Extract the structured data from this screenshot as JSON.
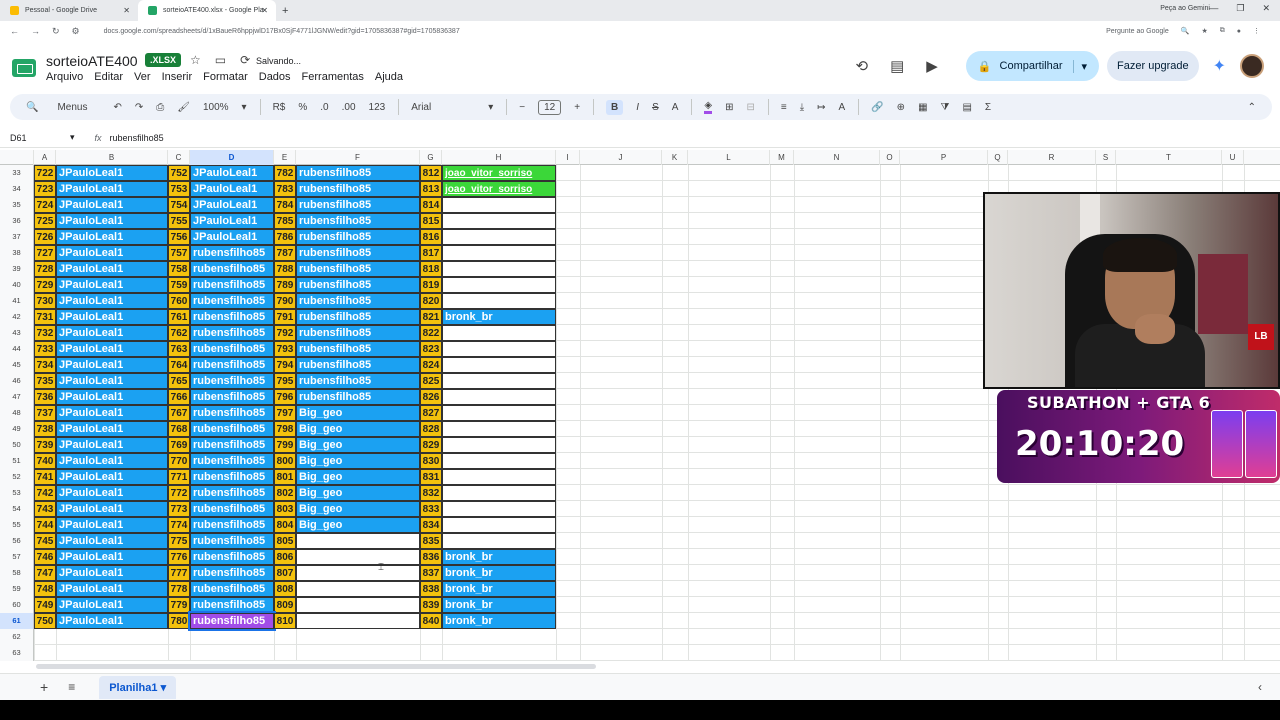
{
  "browser": {
    "tabs": [
      {
        "label": "Pessoal - Google Drive",
        "active": false
      },
      {
        "label": "sorteioATE400.xlsx - Google Pla",
        "active": true
      }
    ],
    "gemini_label": "Peça ao Gemini",
    "url": "docs.google.com/spreadsheets/d/1xBaueR6hppjwlD17Bx0SjF4771lJGNW/edit?gid=1705836387#gid=1705836387",
    "gemini_ask": "Pergunte ao Google"
  },
  "doc": {
    "title": "sorteioATE400",
    "badge": ".XLSX",
    "status": "Salvando...",
    "menus": [
      "Arquivo",
      "Editar",
      "Ver",
      "Inserir",
      "Formatar",
      "Dados",
      "Ferramentas",
      "Ajuda"
    ],
    "share_label": "Compartilhar",
    "upgrade_label": "Fazer upgrade"
  },
  "toolbar": {
    "menus_label": "Menus",
    "zoom": "100%",
    "currency": "R$",
    "percent": "%",
    "dec_less": ".0",
    "dec_more": ".00",
    "format_123": "123",
    "font": "Arial",
    "font_size": "12"
  },
  "formula_bar": {
    "cell_ref": "D61",
    "fx": "fx",
    "content": "rubensfilho85"
  },
  "columns": [
    "A",
    "B",
    "C",
    "D",
    "E",
    "F",
    "G",
    "H",
    "I",
    "J",
    "K",
    "L",
    "M",
    "N",
    "O",
    "P",
    "Q",
    "R",
    "S",
    "T",
    "U"
  ],
  "rows": [
    {
      "n": "33",
      "a": "722",
      "b": "JPauloLeal1",
      "c": "752",
      "d": "JPauloLeal1",
      "e": "782",
      "f": "rubensfilho85",
      "g": "812",
      "h": "joao_vitor_sorriso",
      "hs": "green"
    },
    {
      "n": "34",
      "a": "723",
      "b": "JPauloLeal1",
      "c": "753",
      "d": "JPauloLeal1",
      "e": "783",
      "f": "rubensfilho85",
      "g": "813",
      "h": "joao_vitor_sorriso",
      "hs": "green"
    },
    {
      "n": "35",
      "a": "724",
      "b": "JPauloLeal1",
      "c": "754",
      "d": "JPauloLeal1",
      "e": "784",
      "f": "rubensfilho85",
      "g": "814",
      "h": "",
      "hs": "blank"
    },
    {
      "n": "36",
      "a": "725",
      "b": "JPauloLeal1",
      "c": "755",
      "d": "JPauloLeal1",
      "e": "785",
      "f": "rubensfilho85",
      "g": "815",
      "h": "",
      "hs": "blank"
    },
    {
      "n": "37",
      "a": "726",
      "b": "JPauloLeal1",
      "c": "756",
      "d": "JPauloLeal1",
      "e": "786",
      "f": "rubensfilho85",
      "g": "816",
      "h": "",
      "hs": "blank"
    },
    {
      "n": "38",
      "a": "727",
      "b": "JPauloLeal1",
      "c": "757",
      "d": "rubensfilho85",
      "e": "787",
      "f": "rubensfilho85",
      "g": "817",
      "h": "",
      "hs": "blank"
    },
    {
      "n": "39",
      "a": "728",
      "b": "JPauloLeal1",
      "c": "758",
      "d": "rubensfilho85",
      "e": "788",
      "f": "rubensfilho85",
      "g": "818",
      "h": "",
      "hs": "blank"
    },
    {
      "n": "40",
      "a": "729",
      "b": "JPauloLeal1",
      "c": "759",
      "d": "rubensfilho85",
      "e": "789",
      "f": "rubensfilho85",
      "g": "819",
      "h": "",
      "hs": "blank"
    },
    {
      "n": "41",
      "a": "730",
      "b": "JPauloLeal1",
      "c": "760",
      "d": "rubensfilho85",
      "e": "790",
      "f": "rubensfilho85",
      "g": "820",
      "h": "",
      "hs": "blank"
    },
    {
      "n": "42",
      "a": "731",
      "b": "JPauloLeal1",
      "c": "761",
      "d": "rubensfilho85",
      "e": "791",
      "f": "rubensfilho85",
      "g": "821",
      "h": "bronk_br",
      "hs": "name"
    },
    {
      "n": "43",
      "a": "732",
      "b": "JPauloLeal1",
      "c": "762",
      "d": "rubensfilho85",
      "e": "792",
      "f": "rubensfilho85",
      "g": "822",
      "h": "",
      "hs": "blank"
    },
    {
      "n": "44",
      "a": "733",
      "b": "JPauloLeal1",
      "c": "763",
      "d": "rubensfilho85",
      "e": "793",
      "f": "rubensfilho85",
      "g": "823",
      "h": "",
      "hs": "blank"
    },
    {
      "n": "45",
      "a": "734",
      "b": "JPauloLeal1",
      "c": "764",
      "d": "rubensfilho85",
      "e": "794",
      "f": "rubensfilho85",
      "g": "824",
      "h": "",
      "hs": "blank"
    },
    {
      "n": "46",
      "a": "735",
      "b": "JPauloLeal1",
      "c": "765",
      "d": "rubensfilho85",
      "e": "795",
      "f": "rubensfilho85",
      "g": "825",
      "h": "",
      "hs": "blank"
    },
    {
      "n": "47",
      "a": "736",
      "b": "JPauloLeal1",
      "c": "766",
      "d": "rubensfilho85",
      "e": "796",
      "f": "rubensfilho85",
      "g": "826",
      "h": "",
      "hs": "blank"
    },
    {
      "n": "48",
      "a": "737",
      "b": "JPauloLeal1",
      "c": "767",
      "d": "rubensfilho85",
      "e": "797",
      "f": "Big_geo",
      "g": "827",
      "h": "",
      "hs": "blank"
    },
    {
      "n": "49",
      "a": "738",
      "b": "JPauloLeal1",
      "c": "768",
      "d": "rubensfilho85",
      "e": "798",
      "f": "Big_geo",
      "g": "828",
      "h": "",
      "hs": "blank"
    },
    {
      "n": "50",
      "a": "739",
      "b": "JPauloLeal1",
      "c": "769",
      "d": "rubensfilho85",
      "e": "799",
      "f": "Big_geo",
      "g": "829",
      "h": "",
      "hs": "blank"
    },
    {
      "n": "51",
      "a": "740",
      "b": "JPauloLeal1",
      "c": "770",
      "d": "rubensfilho85",
      "e": "800",
      "f": "Big_geo",
      "g": "830",
      "h": "",
      "hs": "blank"
    },
    {
      "n": "52",
      "a": "741",
      "b": "JPauloLeal1",
      "c": "771",
      "d": "rubensfilho85",
      "e": "801",
      "f": "Big_geo",
      "g": "831",
      "h": "",
      "hs": "blank"
    },
    {
      "n": "53",
      "a": "742",
      "b": "JPauloLeal1",
      "c": "772",
      "d": "rubensfilho85",
      "e": "802",
      "f": "Big_geo",
      "g": "832",
      "h": "",
      "hs": "blank"
    },
    {
      "n": "54",
      "a": "743",
      "b": "JPauloLeal1",
      "c": "773",
      "d": "rubensfilho85",
      "e": "803",
      "f": "Big_geo",
      "g": "833",
      "h": "",
      "hs": "blank"
    },
    {
      "n": "55",
      "a": "744",
      "b": "JPauloLeal1",
      "c": "774",
      "d": "rubensfilho85",
      "e": "804",
      "f": "Big_geo",
      "g": "834",
      "h": "",
      "hs": "blank"
    },
    {
      "n": "56",
      "a": "745",
      "b": "JPauloLeal1",
      "c": "775",
      "d": "rubensfilho85",
      "e": "805",
      "f": "",
      "g": "835",
      "h": "",
      "hs": "blank"
    },
    {
      "n": "57",
      "a": "746",
      "b": "JPauloLeal1",
      "c": "776",
      "d": "rubensfilho85",
      "e": "806",
      "f": "",
      "g": "836",
      "h": "bronk_br",
      "hs": "name"
    },
    {
      "n": "58",
      "a": "747",
      "b": "JPauloLeal1",
      "c": "777",
      "d": "rubensfilho85",
      "e": "807",
      "f": "",
      "g": "837",
      "h": "bronk_br",
      "hs": "name"
    },
    {
      "n": "59",
      "a": "748",
      "b": "JPauloLeal1",
      "c": "778",
      "d": "rubensfilho85",
      "e": "808",
      "f": "",
      "g": "838",
      "h": "bronk_br",
      "hs": "name"
    },
    {
      "n": "60",
      "a": "749",
      "b": "JPauloLeal1",
      "c": "779",
      "d": "rubensfilho85",
      "e": "809",
      "f": "",
      "g": "839",
      "h": "bronk_br",
      "hs": "name"
    },
    {
      "n": "61",
      "a": "750",
      "b": "JPauloLeal1",
      "c": "780",
      "d": "rubensfilho85",
      "e": "810",
      "f": "",
      "g": "840",
      "h": "bronk_br",
      "hs": "name"
    },
    {
      "n": "62"
    },
    {
      "n": "63"
    }
  ],
  "overlay": {
    "subathon_title": "SUBATHON + GTA 6",
    "timer": "20:10:20"
  },
  "sheet_tabs": {
    "active": "Planilha1"
  },
  "colors": {
    "number_cell": "#f4c20d",
    "name_cell": "#1ba1f2",
    "green_cell": "#3bd739",
    "selected_cell": "#a14de8"
  }
}
